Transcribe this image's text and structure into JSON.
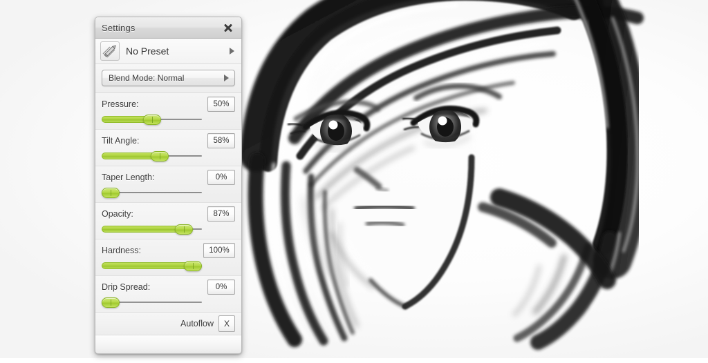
{
  "app": {
    "background_color": "#fdfdfd"
  },
  "panel": {
    "title": "Settings",
    "close_icon": "close-icon",
    "preset": {
      "icon": "pencil-stroke-icon",
      "label": "No Preset",
      "arrow_icon": "arrow-right-icon"
    },
    "blend_mode": {
      "label": "Blend Mode: Normal",
      "arrow_icon": "arrow-right-icon"
    },
    "sliders": [
      {
        "label": "Pressure:",
        "value": "50%",
        "percent": 50
      },
      {
        "label": "Tilt Angle:",
        "value": "58%",
        "percent": 58
      },
      {
        "label": "Taper Length:",
        "value": "0%",
        "percent": 0
      },
      {
        "label": "Opacity:",
        "value": "87%",
        "percent": 87
      },
      {
        "label": "Hardness:",
        "value": "100%",
        "percent": 100
      },
      {
        "label": "Drip Spread:",
        "value": "0%",
        "percent": 0
      }
    ],
    "footer": {
      "autoflow_label": "Autoflow",
      "autoflow_button": "X"
    }
  },
  "canvas": {
    "artwork_name": "anime-girl-face-sketch"
  }
}
